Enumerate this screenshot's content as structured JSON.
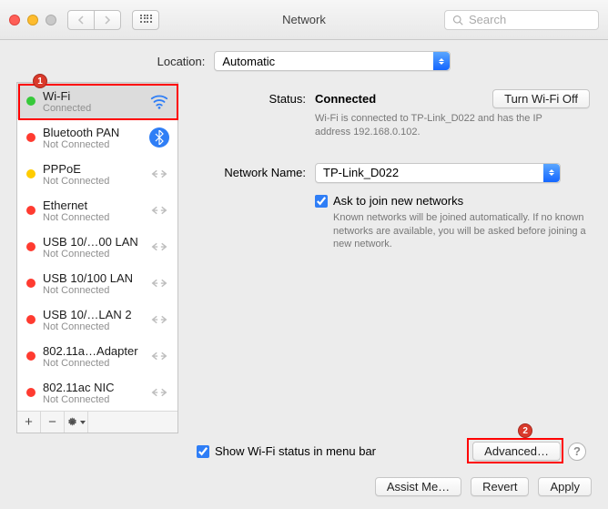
{
  "window": {
    "title": "Network"
  },
  "search": {
    "placeholder": "Search"
  },
  "location": {
    "label": "Location:",
    "value": "Automatic"
  },
  "sidebar": {
    "items": [
      {
        "name": "Wi-Fi",
        "status": "Connected",
        "dot": "green",
        "icon": "wifi"
      },
      {
        "name": "Bluetooth PAN",
        "status": "Not Connected",
        "dot": "red",
        "icon": "bluetooth"
      },
      {
        "name": "PPPoE",
        "status": "Not Connected",
        "dot": "yellow",
        "icon": "arrows"
      },
      {
        "name": "Ethernet",
        "status": "Not Connected",
        "dot": "red",
        "icon": "arrows"
      },
      {
        "name": "USB 10/…00 LAN",
        "status": "Not Connected",
        "dot": "red",
        "icon": "arrows"
      },
      {
        "name": "USB 10/100 LAN",
        "status": "Not Connected",
        "dot": "red",
        "icon": "arrows"
      },
      {
        "name": "USB 10/…LAN 2",
        "status": "Not Connected",
        "dot": "red",
        "icon": "arrows"
      },
      {
        "name": "802.11a…Adapter",
        "status": "Not Connected",
        "dot": "red",
        "icon": "arrows"
      },
      {
        "name": "802.11ac NIC",
        "status": "Not Connected",
        "dot": "red",
        "icon": "arrows"
      }
    ]
  },
  "panel": {
    "status_label": "Status:",
    "status_value": "Connected",
    "turn_off": "Turn Wi-Fi Off",
    "status_sub": "Wi-Fi is connected to TP-Link_D022 and has the IP address 192.168.0.102.",
    "netname_label": "Network Name:",
    "netname_value": "TP-Link_D022",
    "ask_label": "Ask to join new networks",
    "ask_sub": "Known networks will be joined automatically. If no known networks are available, you will be asked before joining a new network.",
    "show_status": "Show Wi-Fi status in menu bar",
    "advanced": "Advanced…"
  },
  "buttons": {
    "assist": "Assist Me…",
    "revert": "Revert",
    "apply": "Apply"
  },
  "annotations": {
    "one": "1",
    "two": "2"
  }
}
